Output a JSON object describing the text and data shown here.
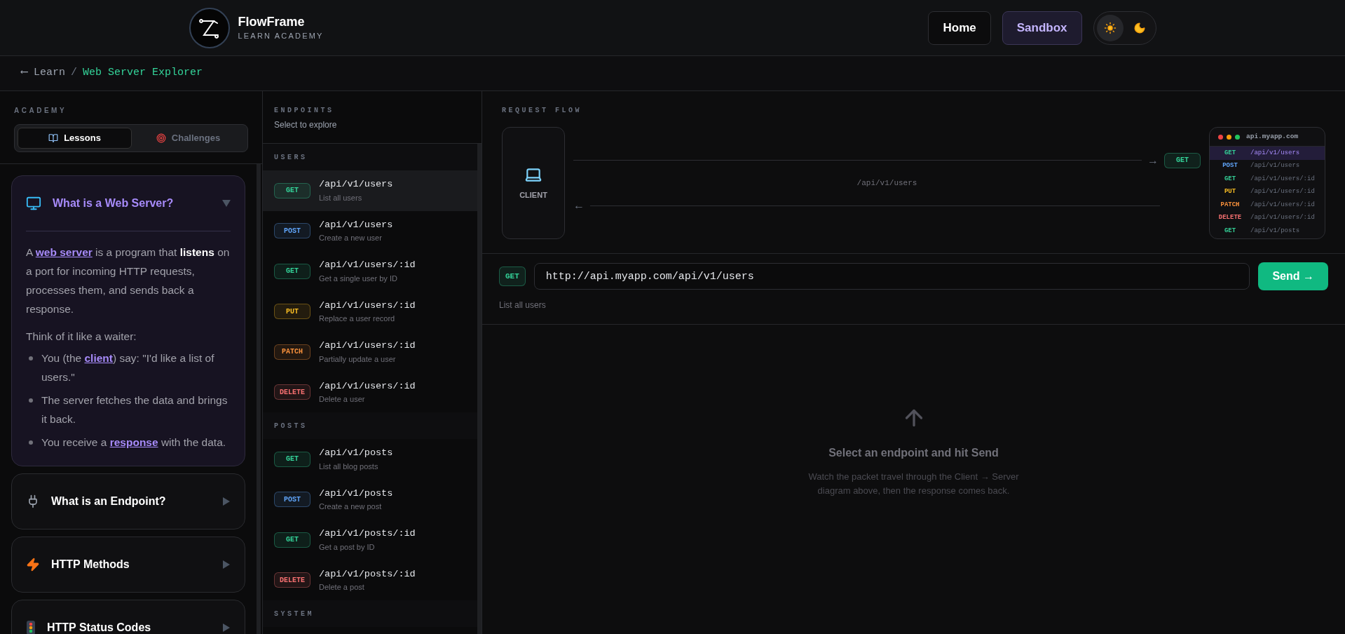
{
  "header": {
    "logo_title": "FlowFrame",
    "logo_subtitle": "LEARN ACADEMY",
    "nav": [
      {
        "label": "Home",
        "selected": false
      },
      {
        "label": "Sandbox",
        "selected": true
      }
    ],
    "theme": [
      {
        "kind": "sun",
        "selected": true
      },
      {
        "kind": "moon",
        "selected": false
      }
    ]
  },
  "breadcrumb": {
    "back": "⟵ Learn",
    "separator": "/",
    "current": "Web Server Explorer"
  },
  "sidebar": {
    "heading": "ACADEMY",
    "tabs": [
      {
        "label": "Lessons",
        "selected": true
      },
      {
        "label": "Challenges",
        "selected": false
      }
    ],
    "lessons": [
      {
        "title": "What is a Web Server?",
        "expanded": true,
        "paragraph": [
          {
            "kind": "text",
            "text": "A "
          },
          {
            "kind": "link",
            "text": "web server"
          },
          {
            "kind": "text",
            "text": " is a program that "
          },
          {
            "kind": "bold",
            "text": "listens"
          },
          {
            "kind": "text",
            "text": " on a port for incoming HTTP requests, processes them, and sends back a response."
          }
        ],
        "intro": "Think of it like a waiter:",
        "bullets": [
          [
            {
              "kind": "text",
              "text": "You (the "
            },
            {
              "kind": "link",
              "text": "client"
            },
            {
              "kind": "text",
              "text": ") say: \"I'd like a list of users.\""
            }
          ],
          [
            {
              "kind": "text",
              "text": "The server fetches the data and brings it back."
            }
          ],
          [
            {
              "kind": "text",
              "text": "You receive a "
            },
            {
              "kind": "link",
              "text": "response"
            },
            {
              "kind": "text",
              "text": " with the data."
            }
          ]
        ]
      },
      {
        "title": "What is an Endpoint?",
        "expanded": false
      },
      {
        "title": "HTTP Methods",
        "expanded": false
      },
      {
        "title": "HTTP Status Codes",
        "expanded": false
      }
    ]
  },
  "endpoints": {
    "heading": "ENDPOINTS",
    "subheading": "Select to explore",
    "groups": [
      {
        "label": "USERS",
        "items": [
          {
            "method": "GET",
            "color": "#34d399",
            "path": "/api/v1/users",
            "description": "List all users",
            "selected": true
          },
          {
            "method": "POST",
            "color": "#60a5fa",
            "path": "/api/v1/users",
            "description": "Create a new user",
            "selected": false
          },
          {
            "method": "GET",
            "color": "#34d399",
            "path": "/api/v1/users/:id",
            "description": "Get a single user by ID",
            "selected": false
          },
          {
            "method": "PUT",
            "color": "#fbbf24",
            "path": "/api/v1/users/:id",
            "description": "Replace a user record",
            "selected": false
          },
          {
            "method": "PATCH",
            "color": "#fb923c",
            "path": "/api/v1/users/:id",
            "description": "Partially update a user",
            "selected": false
          },
          {
            "method": "DELETE",
            "color": "#f87171",
            "path": "/api/v1/users/:id",
            "description": "Delete a user",
            "selected": false
          }
        ]
      },
      {
        "label": "POSTS",
        "items": [
          {
            "method": "GET",
            "color": "#34d399",
            "path": "/api/v1/posts",
            "description": "List all blog posts",
            "selected": false
          },
          {
            "method": "POST",
            "color": "#60a5fa",
            "path": "/api/v1/posts",
            "description": "Create a new post",
            "selected": false
          },
          {
            "method": "GET",
            "color": "#34d399",
            "path": "/api/v1/posts/:id",
            "description": "Get a post by ID",
            "selected": false
          },
          {
            "method": "DELETE",
            "color": "#f87171",
            "path": "/api/v1/posts/:id",
            "description": "Delete a post",
            "selected": false
          }
        ]
      },
      {
        "label": "SYSTEM"
      }
    ]
  },
  "flow": {
    "heading": "REQUEST FLOW",
    "client_label": "CLIENT",
    "method": "GET",
    "color": "#34d399",
    "path": "/api/v1/users",
    "forward_arrow": "→",
    "back_arrow": "←",
    "server": {
      "host": "api.myapp.com",
      "routes": [
        {
          "method": "GET",
          "color": "#34d399",
          "path": "/api/v1/users",
          "selected": true
        },
        {
          "method": "POST",
          "color": "#60a5fa",
          "path": "/api/v1/users",
          "selected": false
        },
        {
          "method": "GET",
          "color": "#34d399",
          "path": "/api/v1/users/:id",
          "selected": false
        },
        {
          "method": "PUT",
          "color": "#fbbf24",
          "path": "/api/v1/users/:id",
          "selected": false
        },
        {
          "method": "PATCH",
          "color": "#fb923c",
          "path": "/api/v1/users/:id",
          "selected": false
        },
        {
          "method": "DELETE",
          "color": "#f87171",
          "path": "/api/v1/users/:id",
          "selected": false
        },
        {
          "method": "GET",
          "color": "#34d399",
          "path": "/api/v1/posts",
          "selected": false
        }
      ]
    }
  },
  "request": {
    "method": "GET",
    "color": "#34d399",
    "url": "http://api.myapp.com/api/v1/users",
    "button": "Send →",
    "description": "List all users"
  },
  "empty": {
    "title": "Select an endpoint and hit Send",
    "text": "Watch the packet travel through the Client → Server diagram above, then the response comes back."
  }
}
